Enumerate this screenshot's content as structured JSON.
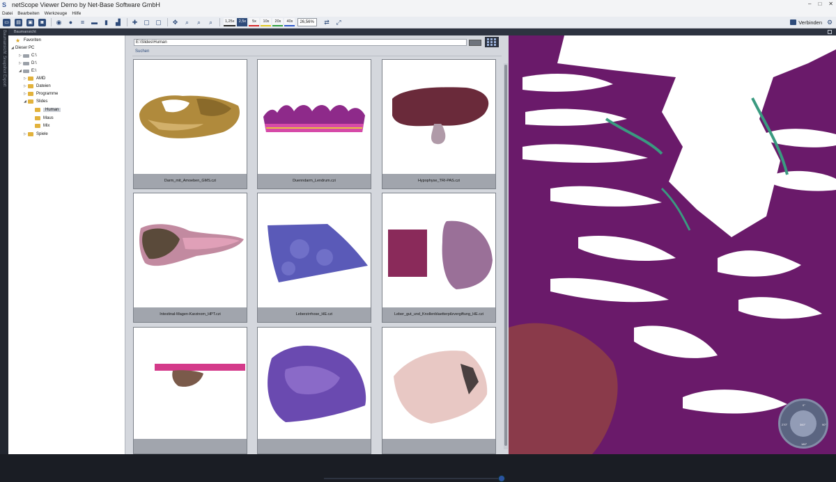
{
  "window": {
    "title": "netScope Viewer Demo by Net-Base Software GmbH",
    "controls": [
      "–",
      "□",
      "✕"
    ]
  },
  "menu": [
    "Datei",
    "Bearbeiten",
    "Werkzeuge",
    "Hilfe"
  ],
  "toolbar": {
    "zoom_levels": [
      "1,25x",
      "2,5x",
      "5x",
      "10x",
      "20x",
      "40x"
    ],
    "zoom_colors": [
      "#222222",
      "#2e4b7a",
      "#d62828",
      "#e0c81e",
      "#2e9e3e",
      "#2a55c8"
    ],
    "active_zoom": "2,5x",
    "zoom_value": "26,56%",
    "connect_label": "Verbinden"
  },
  "side_tabs": [
    "Baumansicht",
    "Snapshot",
    "Export"
  ],
  "tree": {
    "header": "Baumansicht",
    "items": [
      {
        "label": "Favoriten",
        "kind": "star"
      },
      {
        "label": "Dieser PC",
        "kind": "pc"
      },
      {
        "label": "C:\\",
        "kind": "drive"
      },
      {
        "label": "D:\\",
        "kind": "drive"
      },
      {
        "label": "E:\\",
        "kind": "drive"
      },
      {
        "label": "AMD",
        "kind": "folder"
      },
      {
        "label": "Dateien",
        "kind": "folder"
      },
      {
        "label": "Programme",
        "kind": "folder"
      },
      {
        "label": "Slides",
        "kind": "folder"
      },
      {
        "label": "Human",
        "kind": "folder",
        "selected": true
      },
      {
        "label": "Maus",
        "kind": "folder"
      },
      {
        "label": "Mix",
        "kind": "folder"
      },
      {
        "label": "Spiele",
        "kind": "folder"
      }
    ]
  },
  "gallery": {
    "path": "E:\\Slides\\Human",
    "search_label": "Suchen",
    "items": [
      "Darm_mit_Amoeben_GMS.czi",
      "Duenndarm_Lendrum.czi",
      "Hypophyse_TRI-PAS.czi",
      "Intestinal-Magen-Karzinom_HPT.czi",
      "Leberzirrhose_HE.czi",
      "Leber_gut_und_Knollenblaetterpilzvergiftung_HE.czi",
      "",
      "",
      ""
    ]
  },
  "compass": {
    "labels": [
      "0°",
      "90°",
      "180°",
      "270°",
      "360°"
    ]
  }
}
